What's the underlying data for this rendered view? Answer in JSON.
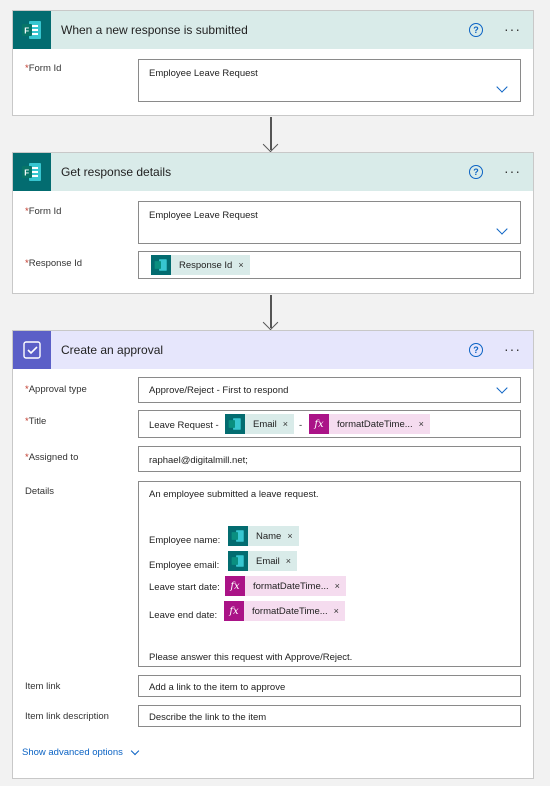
{
  "steps": [
    {
      "title": "When a new response is submitted",
      "fields": {
        "form_id_label": "Form Id",
        "form_id_value": "Employee Leave Request"
      }
    },
    {
      "title": "Get response details",
      "fields": {
        "form_id_label": "Form Id",
        "form_id_value": "Employee Leave Request",
        "response_id_label": "Response Id",
        "response_id_token": "Response Id"
      }
    },
    {
      "title": "Create an approval",
      "approval_type_label": "Approval type",
      "approval_type_value": "Approve/Reject - First to respond",
      "title_label": "Title",
      "title_prefix": "Leave Request -",
      "title_token_email": "Email",
      "title_sep": "-",
      "title_token_expr": "formatDateTime...",
      "assigned_label": "Assigned to",
      "assigned_value": "raphael@digitalmill.net;",
      "details_label": "Details",
      "details": {
        "intro": "An employee submitted a leave request.",
        "name_label": "Employee name:",
        "name_token": "Name",
        "email_label": "Employee email:",
        "email_token": "Email",
        "start_label": "Leave start date:",
        "start_token": "formatDateTime...",
        "end_label": "Leave end date:",
        "end_token": "formatDateTime...",
        "closing": "Please answer this request with Approve/Reject."
      },
      "item_link_label": "Item link",
      "item_link_placeholder": "Add a link to the item to approve",
      "item_link_desc_label": "Item link description",
      "item_link_desc_placeholder": "Describe the link to the item",
      "show_advanced": "Show advanced options"
    }
  ],
  "common": {
    "required_mark": "*",
    "remove_glyph": "×",
    "more_glyph": "···",
    "help_glyph": "?",
    "fx_glyph": "fx"
  },
  "colors": {
    "forms_brand": "#036c70",
    "approval_brand": "#5b5fc7",
    "expression": "#aa1387",
    "link": "#0b63c4"
  }
}
